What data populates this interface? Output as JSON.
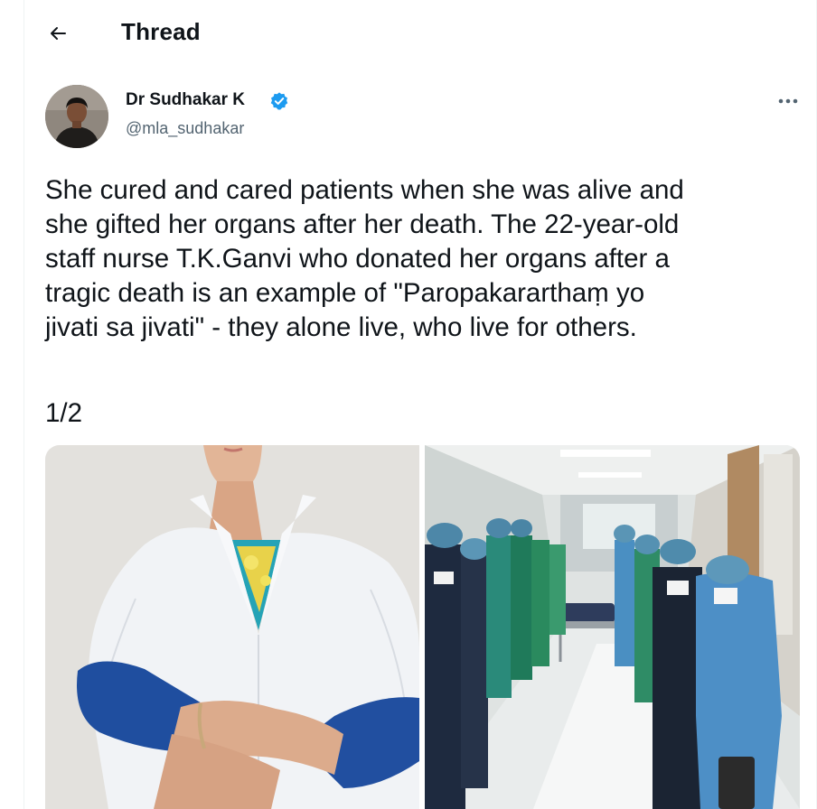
{
  "header": {
    "title": "Thread",
    "back_icon": "arrow-left-icon"
  },
  "tweet": {
    "author_name": "Dr Sudhakar K",
    "author_handle": "@mla_sudhakar",
    "verified_icon": "verified-badge-icon",
    "more_icon": "more-horizontal-icon",
    "text_lines": [
      "She cured and cared patients when she was alive and",
      "she gifted her organs after her death. The 22-year-old",
      "staff nurse T.K.Ganvi who donated her organs after a",
      "tragic death is an example of \"Paropakararthaṃ yo",
      "jivati sa jivati\" - they alone live, who live for others."
    ],
    "thread_count": "1/2"
  },
  "colors": {
    "text": "#0f1419",
    "secondary_text": "#536471",
    "verified_blue": "#1d9bf0",
    "divider": "#eff3f4"
  }
}
